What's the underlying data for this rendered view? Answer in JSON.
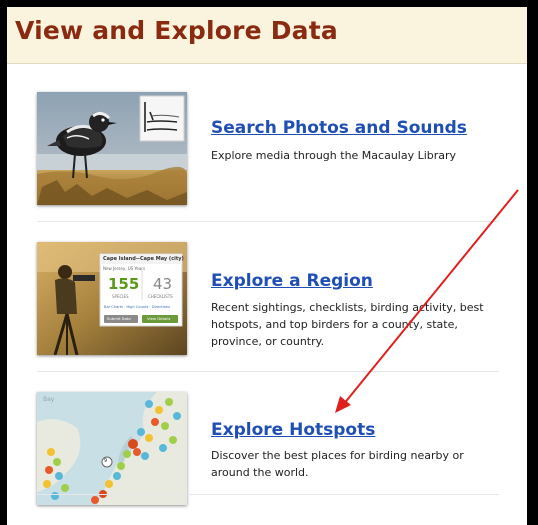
{
  "header": {
    "title": "View and Explore Data"
  },
  "cards": [
    {
      "title": "Search Photos and Sounds",
      "description": "Explore media through the Macaulay Library",
      "image": "bird-photo-thumbnail"
    },
    {
      "title": "Explore a Region",
      "description": "Recent sightings, checklists, birding activity, best hotspots, and top birders for a county, state, province, or country.",
      "image": "region-summary-thumbnail",
      "thumbnail_panel": {
        "title": "Cape Island--Cape May (city)",
        "subtitle": "New Jersey, US  Years",
        "species_count": "155",
        "species_label": "SPECIES",
        "checklists_count": "43",
        "checklists_label": "CHECKLISTS",
        "links": "Bar Charts · High Counts · Directions",
        "button_left": "Submit Data",
        "button_right": "View Details"
      }
    },
    {
      "title": "Explore Hotspots",
      "description": "Discover the best places for birding nearby or around the world.",
      "image": "hotspot-map-thumbnail",
      "map_label": "Bay",
      "map_marker_number": "9"
    }
  ],
  "colors": {
    "header_bg": "#faf3dd",
    "header_text": "#8a2a10",
    "link": "#1f4fb3",
    "arrow": "#e0201c"
  }
}
